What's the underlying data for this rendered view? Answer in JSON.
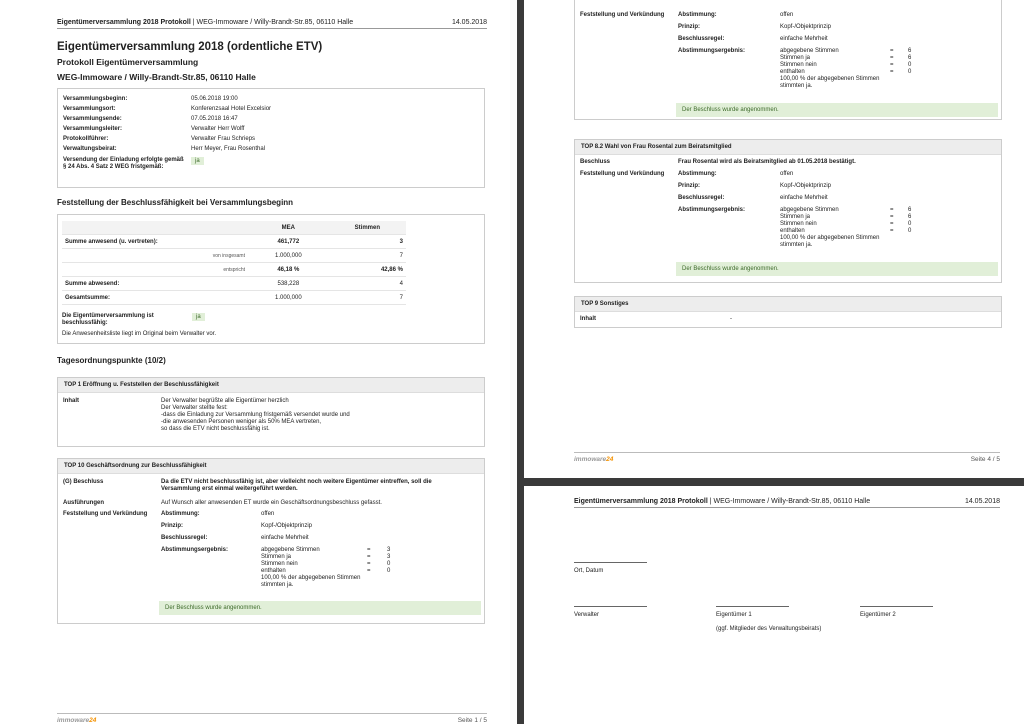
{
  "header": {
    "title_bold": "Eigentümerversammlung 2018 Protokoll",
    "title_rest": " | WEG-Immoware / Willy-Brandt-Str.85, 06110 Halle",
    "date": "14.05.2018"
  },
  "footer": {
    "logo_a": "immoware",
    "logo_b": "24",
    "page1": "Seite 1 / 5",
    "page4": "Seite 4 / 5"
  },
  "page1": {
    "title": "Eigentümerversammlung 2018 (ordentliche ETV)",
    "subtitle": "Protokoll Eigentümerversammlung",
    "address": "WEG-Immoware / Willy-Brandt-Str.85, 06110 Halle",
    "info": [
      {
        "label": "Versammlungsbeginn:",
        "value": "05.06.2018 19:00"
      },
      {
        "label": "Versammlungsort:",
        "value": "Konferenzsaal Hotel Excelsior"
      },
      {
        "label": "Versammlungsende:",
        "value": "07.05.2018 16:47"
      },
      {
        "label": "Versammlungsleiter:",
        "value": "Verwalter Herr Wolff"
      },
      {
        "label": "Protokollführer:",
        "value": "Verwalter Frau Schrieps"
      },
      {
        "label": "Verwaltungsbeirat:",
        "value": "Herr Meyer, Frau Rosenthal"
      }
    ],
    "invite_label": "Versendung der Einladung erfolgte gemäß § 24 Abs. 4 Satz 2 WEG fristgemäß:",
    "invite_value": "ja",
    "quorum_heading": "Feststellung der Beschlussfähigkeit bei Versammlungsbeginn",
    "col_mea": "MEA",
    "col_stimmen": "Stimmen",
    "rows": [
      {
        "label": "Summe anwesend (u. vertreten):",
        "mea": "461,772",
        "st": "3"
      },
      {
        "label": "von insgesamt",
        "mea": "1.000,000",
        "st": "7"
      },
      {
        "label": "entspricht",
        "mea": "46,18 %",
        "st": "42,86 %"
      },
      {
        "label": "Summe abwesend:",
        "mea": "538,228",
        "st": "4"
      },
      {
        "label": "Gesamtsumme:",
        "mea": "1.000,000",
        "st": "7"
      }
    ],
    "quorum_label": "Die Eigentümerversammlung ist beschlussfähig:",
    "quorum_value": "ja",
    "attendance_note": "Die Anwesenheitsliste liegt im Original beim Verwalter vor.",
    "agenda_heading": "Tagesordnungspunkte (10/2)",
    "top1": {
      "title": "TOP 1 Eröffnung u. Feststellen der Beschlussfähigkeit",
      "label": "Inhalt",
      "lines": [
        "Der Verwalter begrüßte alle Eigentümer herzlich",
        "Der Verwalter stellte fest:",
        "-dass die Einladung zur Versammlung fristgemäß versendet wurde und",
        "-die anwesenden Personen weniger als 50% MEA vertreten,",
        "so dass die ETV nicht beschlussfähig ist."
      ]
    },
    "top10": {
      "title": "TOP 10 Geschäftsordnung zur Beschlussfähigkeit",
      "beschluss_label": "(G) Beschluss",
      "beschluss": "Da die ETV nicht beschlussfähig ist, aber vielleicht noch weitere Eigentümer eintreffen, soll die Versammlung erst einmal weitergeführt werden.",
      "ausf_label": "Ausführungen",
      "ausf": "Auf Wunsch aller anwesenden ET wurde ein Geschäftsordnungsbeschluss gefasst.",
      "fv_label": "Feststellung und Verkündung",
      "abst_label": "Abstimmung:",
      "abst": "offen",
      "prinzip_label": "Prinzip:",
      "prinzip": "Kopf-/Objektprinzip",
      "regel_label": "Beschlussregel:",
      "regel": "einfache Mehrheit",
      "erg_label": "Abstimmungsergebnis:",
      "votes": [
        {
          "k": "abgegebene Stimmen",
          "v": "3"
        },
        {
          "k": "Stimmen ja",
          "v": "3"
        },
        {
          "k": "Stimmen nein",
          "v": "0"
        },
        {
          "k": "enthalten",
          "v": "0"
        }
      ],
      "pct": "100,00 % der abgegebenen Stimmen",
      "pct2": "stimmten ja.",
      "result": "Der Beschluss wurde angenommen."
    }
  },
  "page4": {
    "fv_label": "Feststellung und Verkündung",
    "abst_label": "Abstimmung:",
    "abst": "offen",
    "prinzip_label": "Prinzip:",
    "prinzip": "Kopf-/Objektprinzip",
    "regel_label": "Beschlussregel:",
    "regel": "einfache Mehrheit",
    "erg_label": "Abstimmungsergebnis:",
    "votes": [
      {
        "k": "abgegebene Stimmen",
        "v": "6"
      },
      {
        "k": "Stimmen ja",
        "v": "6"
      },
      {
        "k": "Stimmen nein",
        "v": "0"
      },
      {
        "k": "enthalten",
        "v": "0"
      }
    ],
    "pct": "100,00 % der abgegebenen Stimmen",
    "pct2": "stimmten ja.",
    "result": "Der Beschluss wurde angenommen.",
    "top82": {
      "title": "TOP 8.2 Wahl von Frau Rosental zum Beiratsmitglied",
      "beschluss_label": "Beschluss",
      "beschluss": "Frau Rosental wird als Beiratsmitglied ab 01.05.2018 bestätigt."
    },
    "top9": {
      "title": "TOP 9 Sonstiges",
      "label": "Inhalt",
      "value": "-"
    }
  },
  "page5": {
    "ort_datum": "Ort, Datum",
    "verwalter": "Verwalter",
    "et1": "Eigentümer 1",
    "et1_note": "(ggf. Mitglieder des Verwaltungsbeirats)",
    "et2": "Eigentümer 2"
  }
}
